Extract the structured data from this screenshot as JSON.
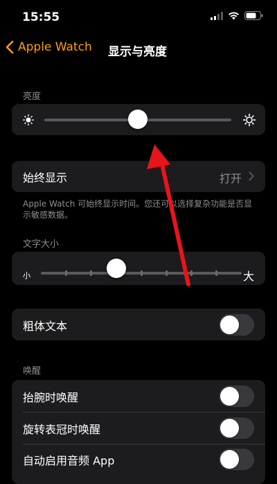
{
  "status_bar": {
    "time": "15:55",
    "icons": [
      "cellular-signal-icon",
      "wifi-icon",
      "battery-icon"
    ]
  },
  "nav": {
    "back_label": "Apple Watch",
    "title": "显示与亮度"
  },
  "brightness": {
    "header": "亮度",
    "level": 0.5,
    "icons": [
      "brightness-low-icon",
      "brightness-high-icon"
    ]
  },
  "always_on": {
    "label": "始终显示",
    "value": "打开",
    "footer": "Apple Watch 可始终显示时间。您还可以选择复杂功能是否显示敏感数据。"
  },
  "text_size": {
    "header": "文字大小",
    "small_label": "小",
    "large_label": "大",
    "step": 3,
    "steps": 9
  },
  "bold_text": {
    "label": "粗体文本",
    "on": false
  },
  "wake": {
    "header": "唤醒",
    "items": [
      {
        "label": "抬腕时唤醒",
        "on": false
      },
      {
        "label": "旋转表冠时唤醒",
        "on": false
      },
      {
        "label": "自动启用音频 App",
        "on": false
      }
    ]
  },
  "colors": {
    "accent": "#FF9F0A",
    "annotation_arrow": "#E8141B",
    "group_background": "#1C1C1E",
    "toggle_off": "#39393D"
  }
}
